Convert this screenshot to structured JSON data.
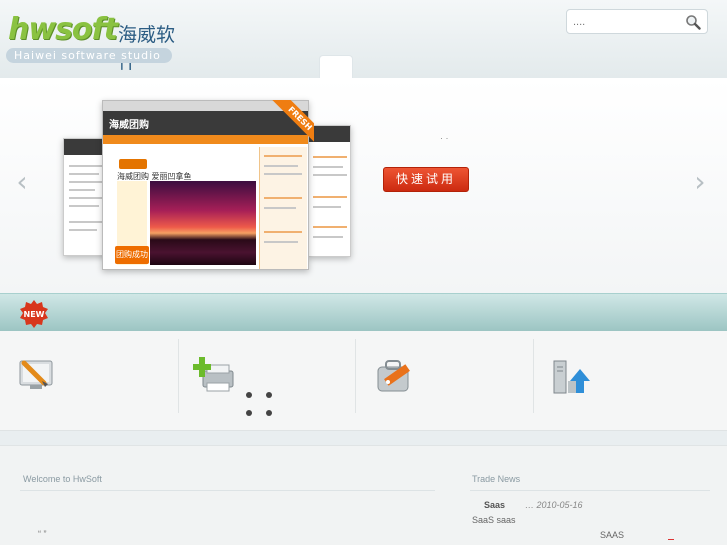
{
  "header": {
    "logo_main": "hwsoft",
    "logo_cn": "海威软件",
    "logo_sub": "Haiwei software studio",
    "search_placeholder": "....",
    "search_icon": "search-icon"
  },
  "banner": {
    "dots": "·  ·",
    "trial_button": "快速试用",
    "prev_arrow": "‹",
    "next_arrow": "›",
    "mockup": {
      "site_title": "海威团购",
      "slogan": "海威团购  爱丽凹拿鱼",
      "tag": "团购成功",
      "ribbon": "FRESH"
    }
  },
  "badge": {
    "label": "NEW"
  },
  "features": {
    "icons": [
      "monitor-pencil-icon",
      "printer-add-icon",
      "toolbox-tag-icon",
      "server-upload-icon"
    ]
  },
  "bottom": {
    "welcome_title": "Welcome to HwSoft",
    "welcome_text": "“   ”",
    "news_title_heading": "Trade News",
    "news": {
      "title": "Saas",
      "date": "… 2010-05-16",
      "sub": "SaaS   saas",
      "extra": "SAAS"
    }
  },
  "colors": {
    "accent": "#cc2a10",
    "logo_green": "#8ac241",
    "teal": "#9cc5c3"
  }
}
